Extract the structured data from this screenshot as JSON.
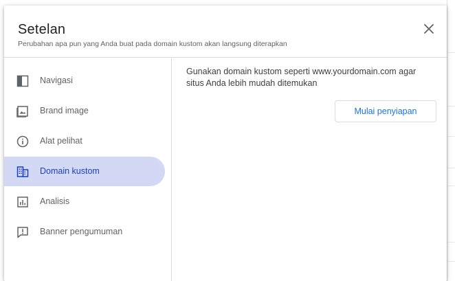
{
  "dialog": {
    "title": "Setelan",
    "subtitle": "Perubahan apa pun yang Anda buat pada domain kustom akan langsung diterapkan"
  },
  "sidebar": {
    "items": [
      {
        "label": "Navigasi",
        "icon": "navigation-panel-icon",
        "active": false
      },
      {
        "label": "Brand image",
        "icon": "brand-image-icon",
        "active": false
      },
      {
        "label": "Alat pelihat",
        "icon": "info-icon",
        "active": false
      },
      {
        "label": "Domain kustom",
        "icon": "domain-icon",
        "active": true
      },
      {
        "label": "Analisis",
        "icon": "analytics-icon",
        "active": false
      },
      {
        "label": "Banner pengumuman",
        "icon": "announcement-icon",
        "active": false
      }
    ]
  },
  "content": {
    "description": "Gunakan domain kustom seperti www.yourdomain.com agar situs Anda lebih mudah ditemukan",
    "button_label": "Mulai penyiapan"
  },
  "colors": {
    "active_bg": "#d3d9f5",
    "active_text": "#1a3fbf",
    "accent": "#1a73e8"
  }
}
